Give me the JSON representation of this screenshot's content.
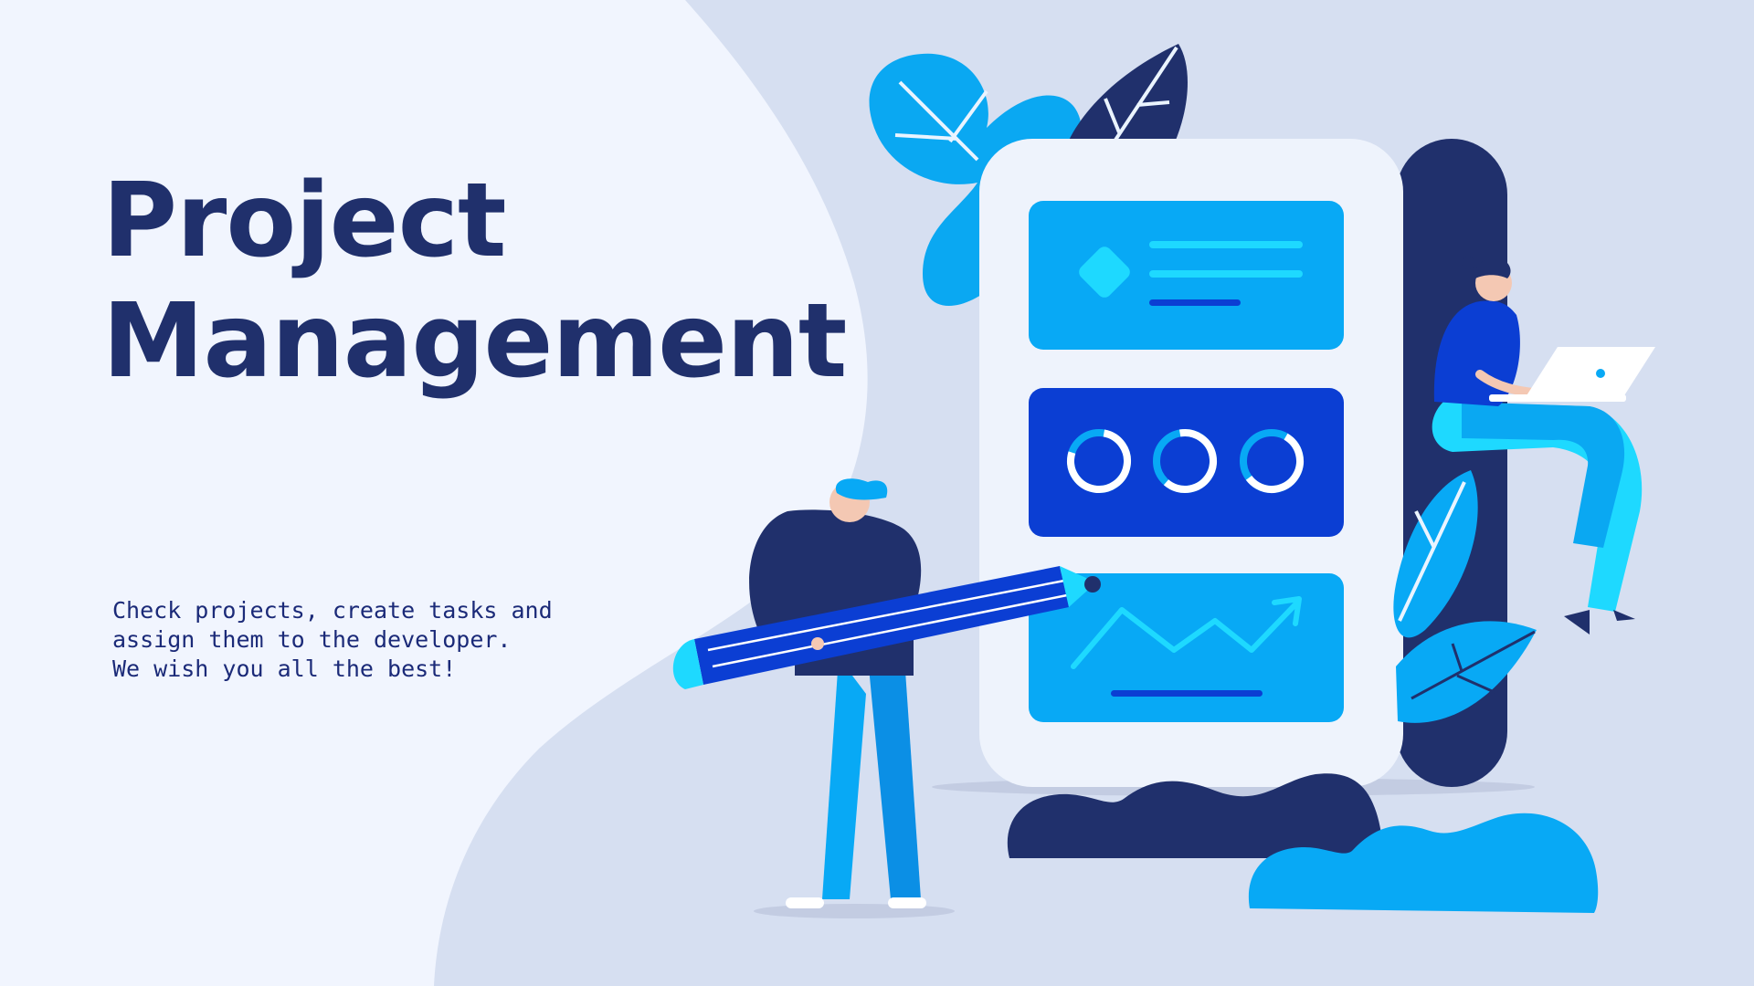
{
  "hero": {
    "title_line_1": "Project",
    "title_line_2": "Management",
    "subtitle_line_1": "Check projects, create tasks and",
    "subtitle_line_2": "assign them to the developer.",
    "subtitle_line_3": "We wish you all the best!"
  },
  "colors": {
    "page_background": "#f1f5fe",
    "wave_background": "#d6dff1",
    "navy": "#20306c",
    "bright_blue": "#08a9f5",
    "royal_blue": "#0b3ed3",
    "cyan": "#1ed9ff",
    "panel_white": "#eef3fc"
  },
  "illustration": {
    "icons": [
      "leaf-icon",
      "diamond-icon",
      "progress-ring-icon",
      "trend-chart-icon",
      "pencil-icon",
      "laptop-icon"
    ]
  }
}
